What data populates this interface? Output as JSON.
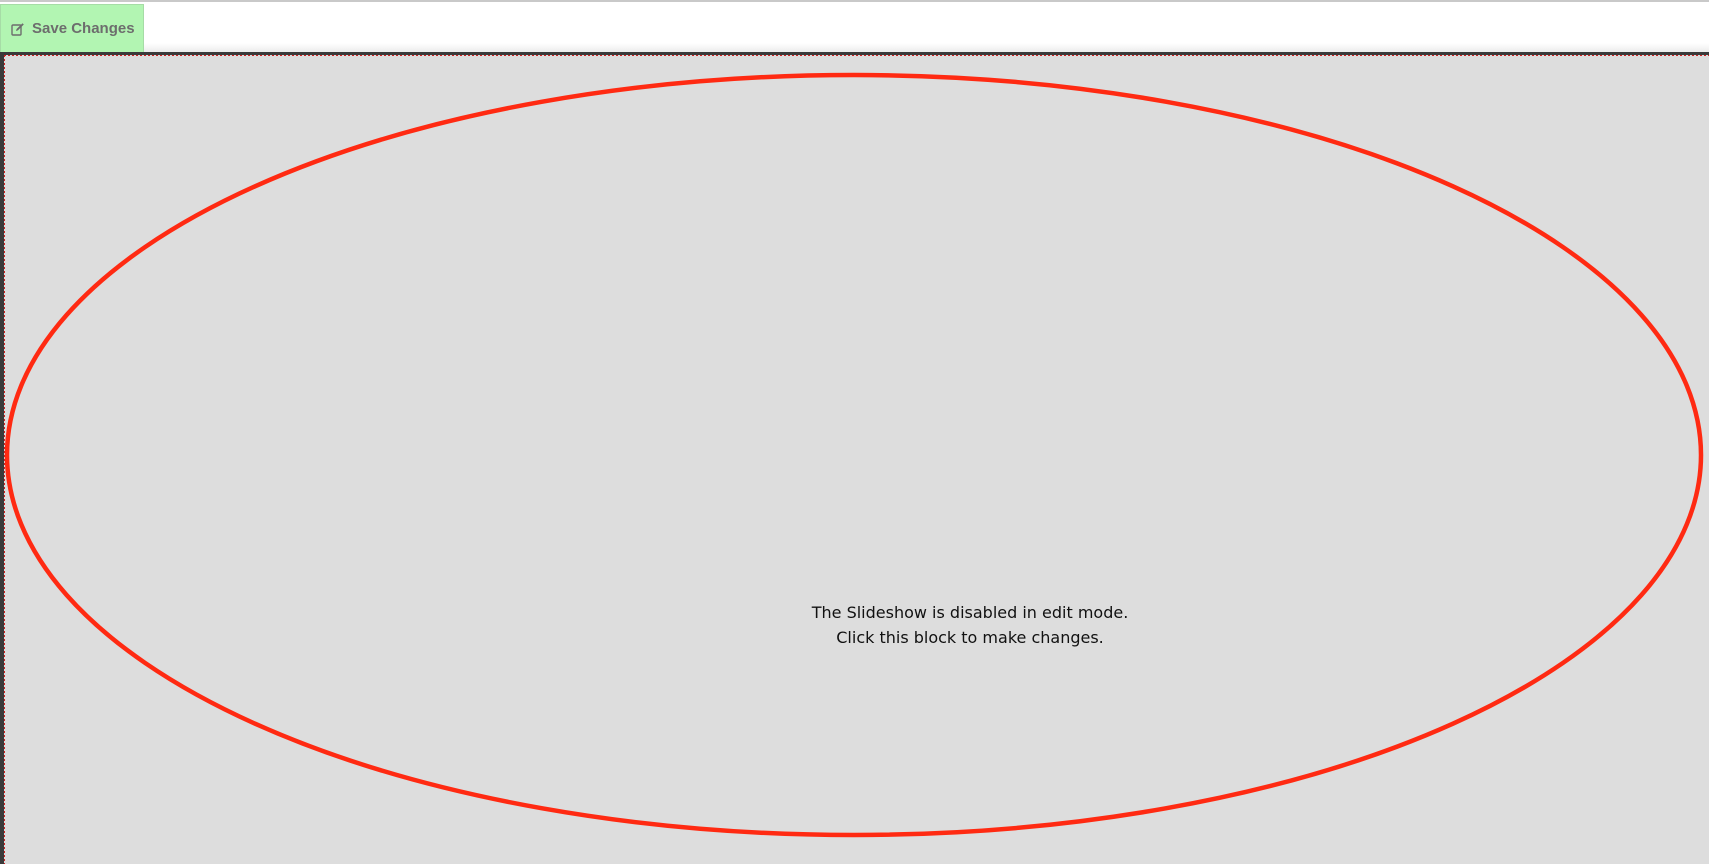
{
  "toolbar": {
    "save_label": "Save Changes",
    "save_icon": "edit-icon",
    "save_color": "#b2f5b2"
  },
  "slideshow_block": {
    "message_line1": "The Slideshow is disabled in edit mode.",
    "message_line2": "Click this block to make changes.",
    "background_color": "#dddddd",
    "highlight_color": "#ff2a12"
  }
}
